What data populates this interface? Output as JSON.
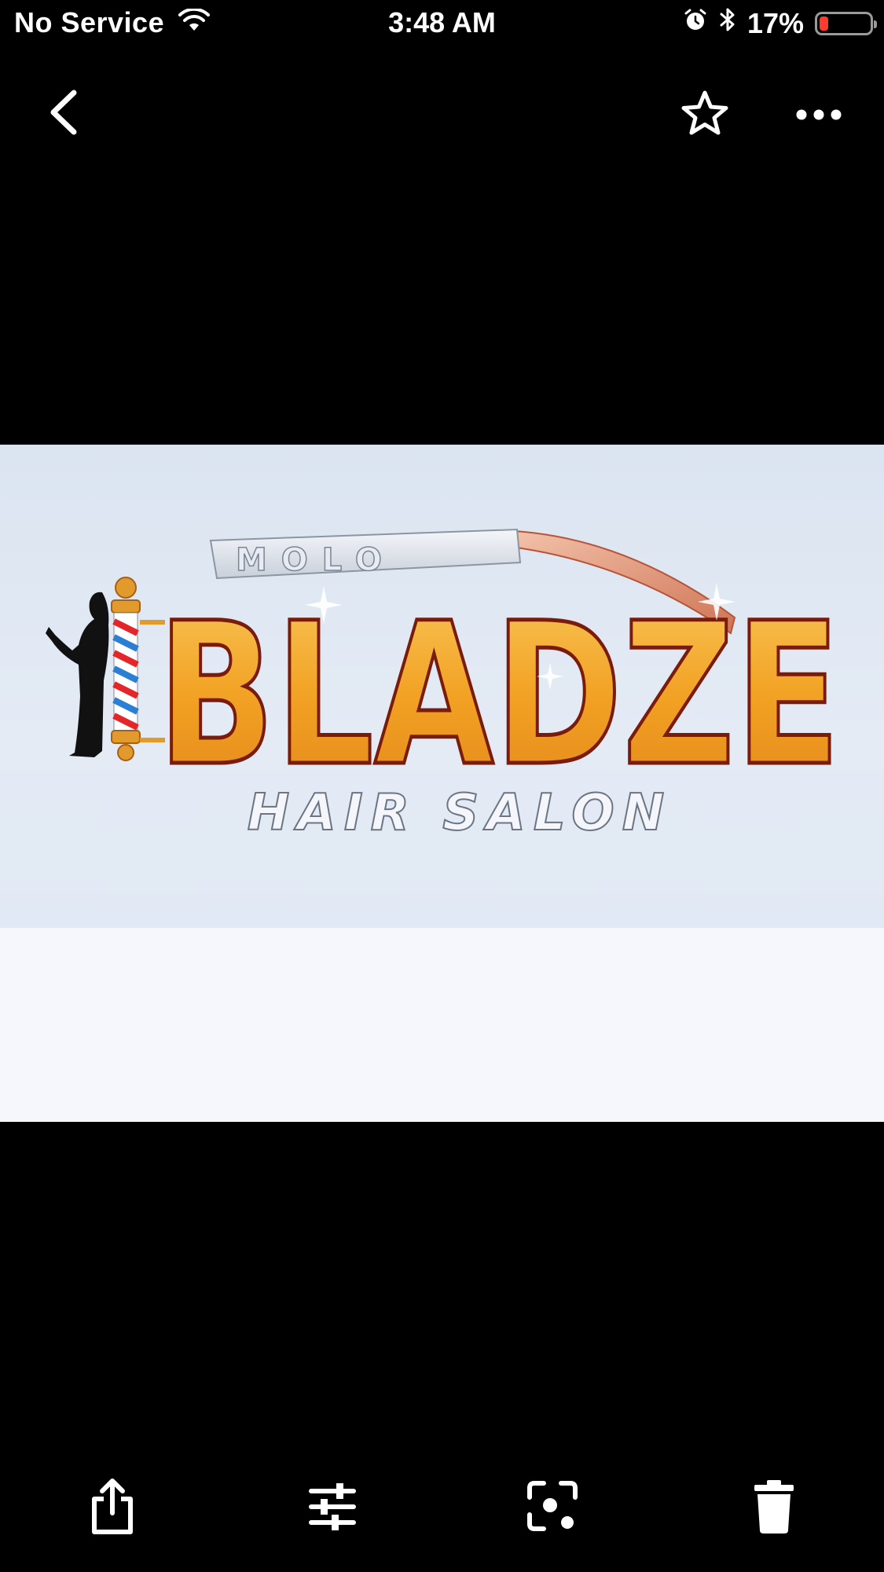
{
  "status_bar": {
    "carrier": "No Service",
    "time": "3:48 AM",
    "battery_percent_label": "17%",
    "battery_level": 0.17,
    "battery_color": "#ff3b30"
  },
  "nav": {
    "back_icon": "chevron-left-icon",
    "favorite_icon": "star-outline-icon",
    "more_icon": "ellipsis-icon"
  },
  "photo": {
    "logo_text_top": "MOLO",
    "logo_text_main": "BLADZE",
    "logo_text_sub": "HAIR SALON",
    "logo_main_color": "#f2a224",
    "logo_outline_color": "#7a1c0c"
  },
  "toolbar": {
    "items": [
      {
        "icon": "share-icon"
      },
      {
        "icon": "adjust-sliders-icon"
      },
      {
        "icon": "lens-search-icon"
      },
      {
        "icon": "trash-icon"
      }
    ]
  }
}
